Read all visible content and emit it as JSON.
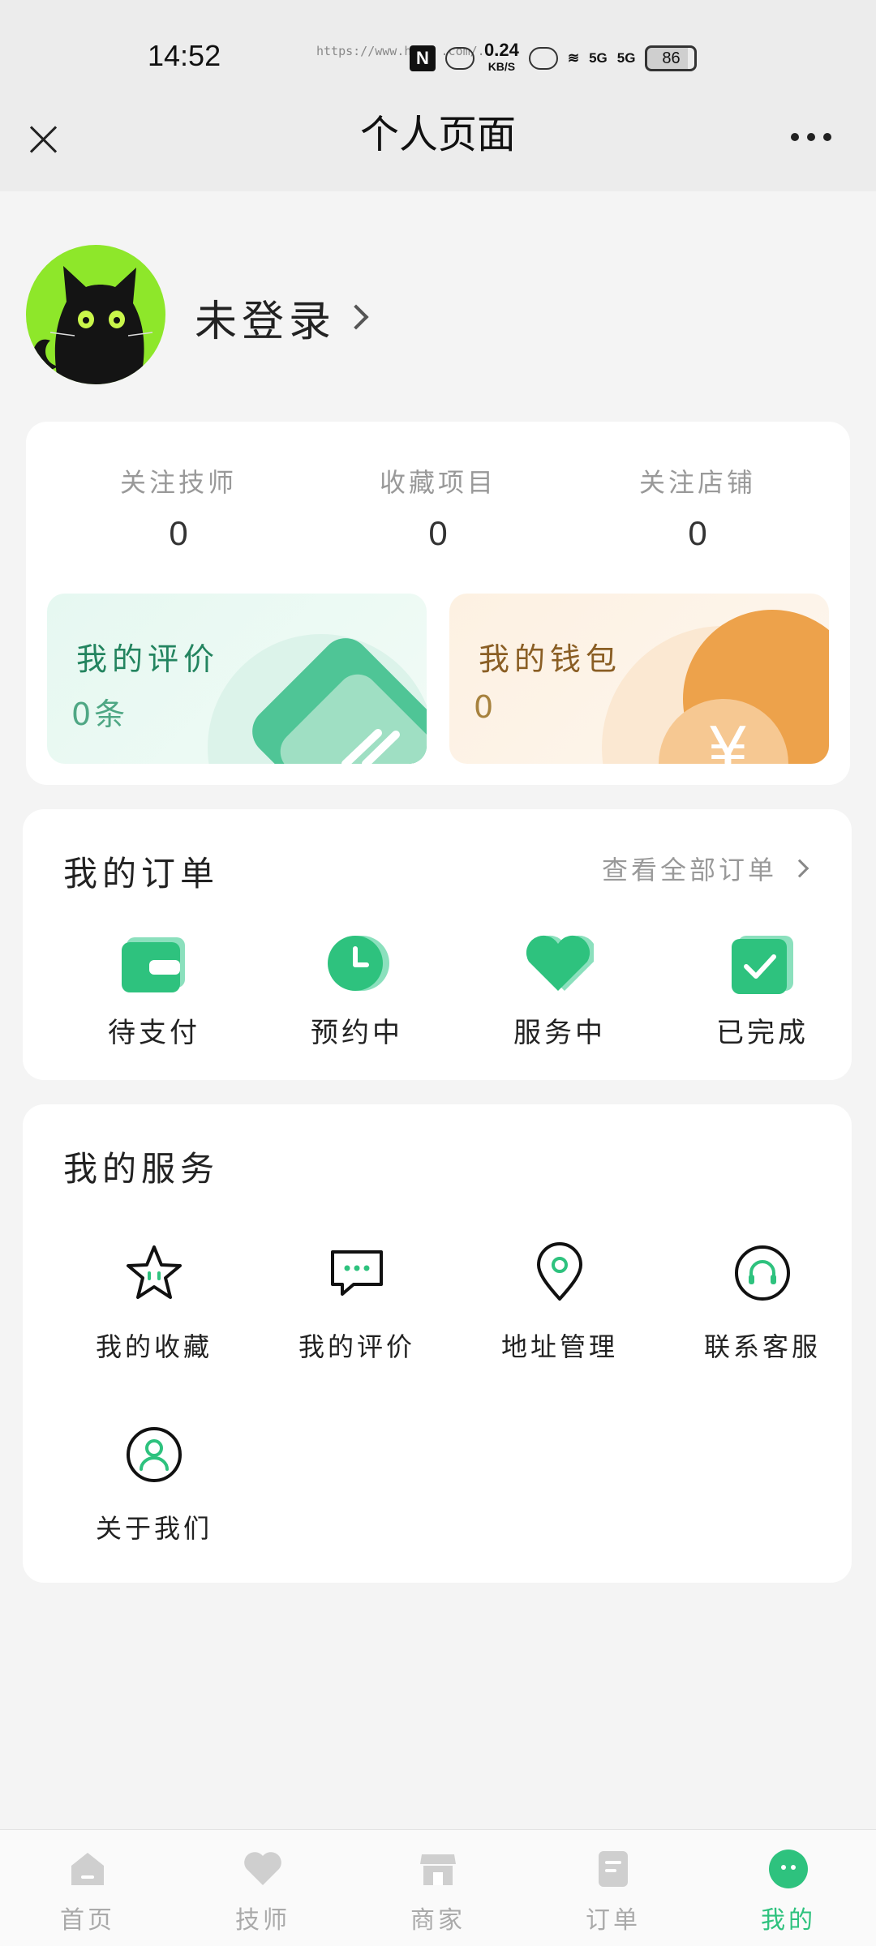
{
  "status_bar": {
    "time": "14:52",
    "url_overlay": "https://www.h... .com/...",
    "net_speed": "0.24",
    "net_unit": "KB/S",
    "sim1": "5G",
    "sim2": "5G",
    "battery": "86"
  },
  "header": {
    "title": "个人页面"
  },
  "profile": {
    "login_text": "未登录"
  },
  "stats": [
    {
      "label": "关注技师",
      "value": "0"
    },
    {
      "label": "收藏项目",
      "value": "0"
    },
    {
      "label": "关注店铺",
      "value": "0"
    }
  ],
  "tiles": {
    "review": {
      "title": "我的评价",
      "value": "0条"
    },
    "wallet": {
      "title": "我的钱包",
      "value": "0"
    }
  },
  "orders": {
    "title": "我的订单",
    "view_all": "查看全部订单",
    "items": [
      {
        "label": "待支付",
        "icon": "wallet-icon"
      },
      {
        "label": "预约中",
        "icon": "clock-icon"
      },
      {
        "label": "服务中",
        "icon": "heart-icon"
      },
      {
        "label": "已完成",
        "icon": "check-icon"
      }
    ]
  },
  "services": {
    "title": "我的服务",
    "items": [
      {
        "label": "我的收藏",
        "icon": "star-icon"
      },
      {
        "label": "我的评价",
        "icon": "chat-icon"
      },
      {
        "label": "地址管理",
        "icon": "location-icon"
      },
      {
        "label": "联系客服",
        "icon": "headset-icon"
      },
      {
        "label": "关于我们",
        "icon": "user-icon"
      }
    ]
  },
  "tabbar": {
    "items": [
      {
        "label": "首页",
        "icon": "home-icon"
      },
      {
        "label": "技师",
        "icon": "heart-icon"
      },
      {
        "label": "商家",
        "icon": "store-icon"
      },
      {
        "label": "订单",
        "icon": "order-icon"
      },
      {
        "label": "我的",
        "icon": "smile-icon",
        "active": true
      }
    ]
  },
  "colors": {
    "accent": "#2ec27e",
    "review_tile": "#e6f8f1",
    "wallet_tile": "#fdf1e2",
    "wallet_orange": "#eda24b",
    "inactive_tab": "#cfcfcf"
  }
}
